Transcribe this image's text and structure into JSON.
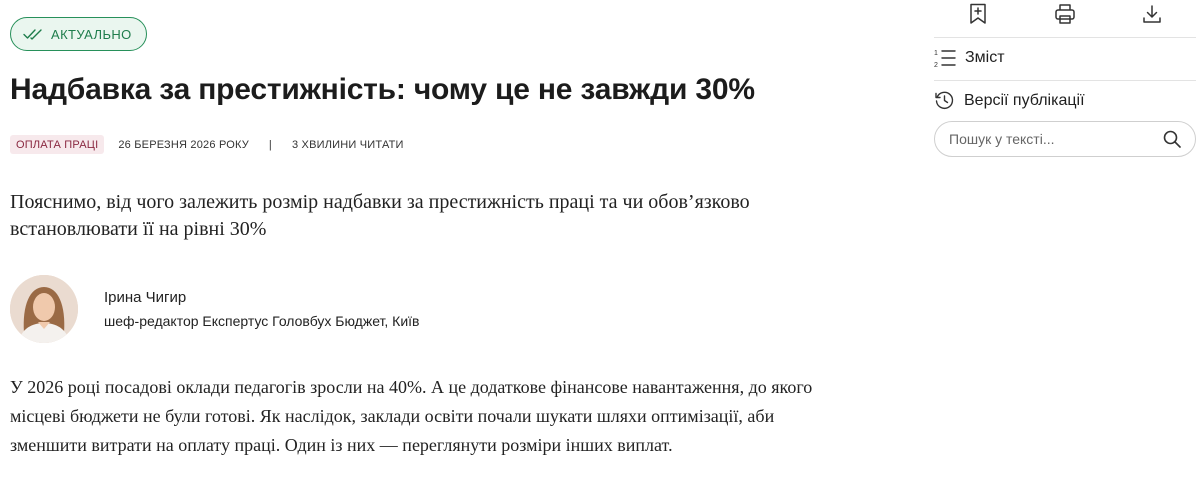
{
  "article": {
    "status_badge": "АКТУАЛЬНО",
    "title": "Надбавка за престижність: чому це не завжди 30%",
    "meta": {
      "tag": "ОПЛАТА ПРАЦІ",
      "date": "26 БЕРЕЗНЯ 2026 РОКУ",
      "separator": "|",
      "read_time": "3 ХВИЛИНИ ЧИТАТИ"
    },
    "lead": "Пояснимо, від чого залежить розмір надбавки за престижність праці та чи обов’язково встановлювати її на рівні 30%",
    "author": {
      "name": "Ірина Чигир",
      "role": "шеф-редактор Експертус Головбух Бюджет, Київ"
    },
    "body": "У 2026 році посадові оклади педагогів зросли на 40%. А це додаткове фінансове навантаження, до якого місцеві бюджети не були готові. Як наслідок, заклади освіти почали шукати шляхи оптимізації, аби зменшити витрати на оплату праці. Один із них — переглянути розміри інших виплат."
  },
  "sidebar": {
    "toolbar": {
      "bookmark_icon": "bookmark-add-icon",
      "print_icon": "printer-icon",
      "download_icon": "download-icon"
    },
    "contents_label": "Зміст",
    "versions_label": "Версії публікації",
    "search": {
      "placeholder": "Пошук у тексті...",
      "value": ""
    }
  },
  "colors": {
    "badge_green": "#27905a",
    "tag_bg": "#f7e9ec",
    "tag_text": "#8a2840",
    "text": "#1f1f1f"
  }
}
